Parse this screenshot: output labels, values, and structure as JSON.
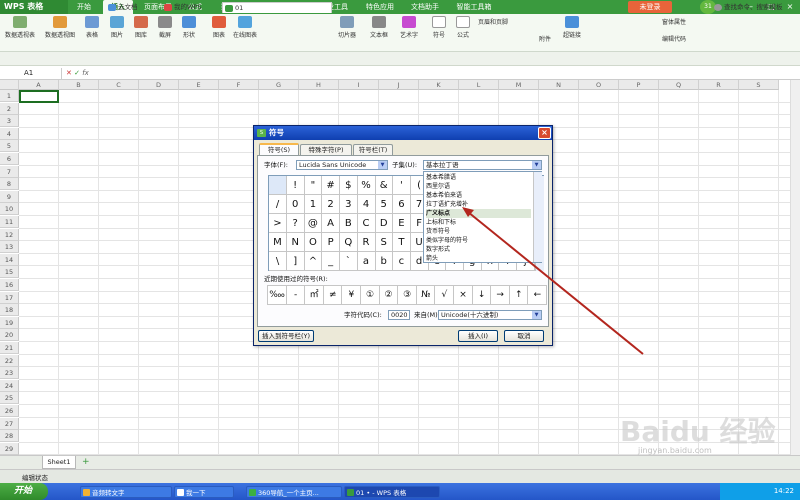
{
  "app": {
    "title": "WPS 表格",
    "login_label": "未登录",
    "avatar_text": "31"
  },
  "menu_tabs": [
    "开始",
    "插入",
    "页面布局",
    "公式",
    "数据",
    "审阅",
    "视图",
    "开发工具",
    "特色应用",
    "文档助手",
    "智能工具箱"
  ],
  "ribbon": [
    "数据透视表",
    "数据透视图",
    "表格",
    "图片",
    "图库",
    "截屏",
    "形状",
    "图表",
    "在线图表",
    "切片器",
    "文本框",
    "艺术字",
    "符号",
    "公式",
    "页眉和页脚",
    "超链接",
    "附件",
    "窗体属性",
    "编辑代码"
  ],
  "quickbar": {
    "tabs": [
      "云文档",
      "我的WPS",
      "01"
    ],
    "right": "查找命令、搜索模板"
  },
  "namebox": "A1",
  "fx_label": "fx",
  "columns": [
    "A",
    "B",
    "C",
    "D",
    "E",
    "F",
    "G",
    "H",
    "I",
    "J",
    "K",
    "L",
    "M",
    "N",
    "O",
    "P",
    "Q",
    "R",
    "S"
  ],
  "rows": [
    "1",
    "2",
    "3",
    "4",
    "5",
    "6",
    "7",
    "8",
    "9",
    "10",
    "11",
    "12",
    "13",
    "14",
    "15",
    "16",
    "17",
    "18",
    "19",
    "20",
    "21",
    "22",
    "23",
    "24",
    "25",
    "26",
    "27",
    "28",
    "29"
  ],
  "sheet": {
    "name": "Sheet1",
    "add": "+"
  },
  "status": "编辑状态",
  "taskbar": {
    "start": "开始",
    "items": [
      "音频转文字",
      "我一下",
      "360导航_一个主页...",
      "01 • - WPS 表格"
    ],
    "time": "14:22"
  },
  "dialog": {
    "title": "符号",
    "close": "×",
    "tabs": [
      "符号(S)",
      "特殊字符(P)",
      "符号栏(T)"
    ],
    "font_label": "字体(F):",
    "font_value": "Lucida Sans Unicode",
    "subset_label": "子集(U):",
    "subset_value": "基本拉丁语",
    "subset_options": [
      "基本希腊语",
      "西里尔语",
      "基本希伯来语",
      "拉丁语扩充增补",
      "广义标点",
      "上标和下标",
      "货币符号",
      "类似字母的符号",
      "数字形式",
      "箭头"
    ],
    "symbols": [
      [
        "",
        "!",
        "\"",
        "#",
        "$",
        "%",
        "&",
        "'",
        "(",
        ")",
        "*",
        "+",
        "",
        "",
        ""
      ],
      [
        "/",
        "0",
        "1",
        "2",
        "3",
        "4",
        "5",
        "6",
        "7",
        "8",
        "9",
        ":",
        ";",
        "<",
        "="
      ],
      [
        ">",
        "?",
        "@",
        "A",
        "B",
        "C",
        "D",
        "E",
        "F",
        "G",
        "H",
        "I",
        "J",
        "K",
        "L"
      ],
      [
        "M",
        "N",
        "O",
        "P",
        "Q",
        "R",
        "S",
        "T",
        "U",
        "V",
        "W",
        "X",
        "Y",
        "Z",
        "["
      ],
      [
        "\\",
        "]",
        "^",
        "_",
        "`",
        "a",
        "b",
        "c",
        "d",
        "e",
        "f",
        "g",
        "h",
        "i",
        "j"
      ]
    ],
    "recent_label": "近期使用过的符号(R):",
    "recent": [
      "‱",
      "-",
      "㎡",
      "≠",
      "¥",
      "①",
      "②",
      "③",
      "№",
      "√",
      "×",
      "↓",
      "→",
      "↑",
      "←"
    ],
    "code_label": "字符代码(C):",
    "code_value": "0020",
    "from_label": "来自(M)",
    "from_value": "Unicode(十六进制)",
    "insert_bar_btn": "插入到符号栏(Y)",
    "insert_btn": "插入(I)",
    "cancel_btn": "取消"
  },
  "watermark": {
    "brand": "Baidu 经验",
    "url": "jingyan.baidu.com"
  },
  "colors": {
    "accent": "#3a9a3e",
    "annotation_arrow": "#b3261e",
    "title_bar": "#1e4fc4"
  }
}
